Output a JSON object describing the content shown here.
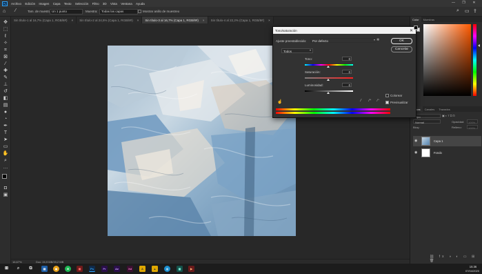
{
  "app": {
    "logo": "Ps",
    "menu": [
      "Archivo",
      "Edición",
      "Imagen",
      "Capa",
      "Texto",
      "Selección",
      "Filtro",
      "3D",
      "Vista",
      "Ventana",
      "Ayuda"
    ],
    "window_buttons": [
      "—",
      "❐",
      "✕"
    ]
  },
  "options_bar": {
    "sample_label": "Tam. de muestra:",
    "sample_value": "Un 1 punto",
    "sample_from_label": "Muestra:",
    "sample_from_value": "Todas las capas",
    "show_ring_label": "Mostrar anillo de muestreo"
  },
  "tabs": [
    {
      "label": "Sin título-1 al 16,7% (Capa 1, RGB/8#)",
      "close": "×",
      "active": false
    },
    {
      "label": "Sin título-2 al 24,5% (Capa 1, RGB/8#)",
      "close": "×",
      "active": false
    },
    {
      "label": "Sin título-3 al 16,7% (Capa 1, RGB/8#)",
      "close": "×",
      "active": true
    },
    {
      "label": "Sin título-4 al 22,2% (Capa 1, RGB/8#)",
      "close": "×",
      "active": false
    }
  ],
  "status_bar": {
    "zoom": "16,67%",
    "doc_info": "Doc: 24,9 MB/33,2 MB"
  },
  "dialog": {
    "title": "Tono/saturación",
    "close": "✕",
    "preset_label": "Ajuste preestablecido:",
    "preset_value": "Por defecto",
    "channel_value": "Todos",
    "ok_label": "OK",
    "cancel_label": "Cancelar",
    "hue_label": "Tono:",
    "hue_value": "0",
    "saturation_label": "Saturación:",
    "saturation_value": "0",
    "lightness_label": "Luminosidad:",
    "lightness_value": "0",
    "colorize_label": "Colorear",
    "colorize_checked": false,
    "preview_label": "Previsualizar",
    "preview_checked": true
  },
  "color_panel": {
    "tabs": [
      "Color",
      "Muestras"
    ],
    "foreground": "#000000",
    "background": "#ffffff"
  },
  "layers_panel": {
    "tabs": [
      "Capas",
      "Canales",
      "Trazados"
    ],
    "kind_filter": "Tipo",
    "blend_mode": "Normal",
    "opacity_label": "Opacidad:",
    "opacity_value": "100%",
    "lock_label": "Bloq.:",
    "fill_label": "Relleno:",
    "fill_value": "100%",
    "layers": [
      {
        "name": "Capa 1",
        "selected": true
      },
      {
        "name": "Fondo",
        "selected": false
      }
    ]
  },
  "taskbar": {
    "time": "15:36",
    "date": "07/04/2020"
  },
  "colors": {
    "accent": "#31a8ff",
    "ok_button": "#1473e6",
    "ui_bg": "#282828"
  }
}
